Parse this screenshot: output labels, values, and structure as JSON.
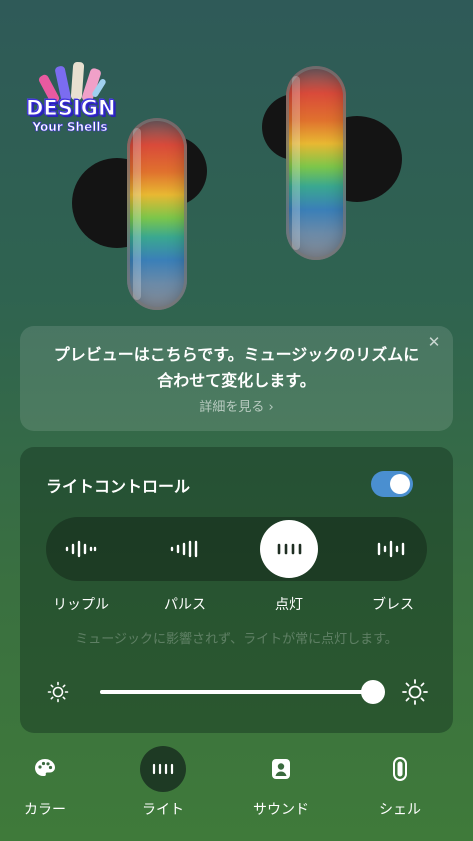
{
  "brand": {
    "logo_line1": "DESIGN",
    "logo_line2": "Your Shells"
  },
  "tip": {
    "text": "プレビューはこちらです。ミュージックのリズムに合わせて変化します。",
    "link_label": "詳細を見る ›",
    "close_icon": "close-icon"
  },
  "light_control": {
    "title": "ライトコントロール",
    "enabled": true,
    "modes": [
      {
        "label": "リップル",
        "icon": "ripple-wave-icon"
      },
      {
        "label": "パルス",
        "icon": "pulse-wave-icon"
      },
      {
        "label": "点灯",
        "icon": "steady-bars-icon",
        "selected": true
      },
      {
        "label": "ブレス",
        "icon": "breathe-wave-icon"
      }
    ],
    "selected_mode": "点灯",
    "hint": "ミュージックに影響されず、ライトが常に点灯します。",
    "brightness_fraction": 1.0
  },
  "nav": {
    "items": [
      {
        "label": "カラー",
        "icon": "palette-icon"
      },
      {
        "label": "ライト",
        "icon": "light-bars-icon",
        "active": true
      },
      {
        "label": "サウンド",
        "icon": "sound-person-icon"
      },
      {
        "label": "シェル",
        "icon": "shell-icon"
      }
    ]
  },
  "colors": {
    "toggle_on": "#4a8fd0",
    "nav_active_bg": "#1e3a24"
  }
}
